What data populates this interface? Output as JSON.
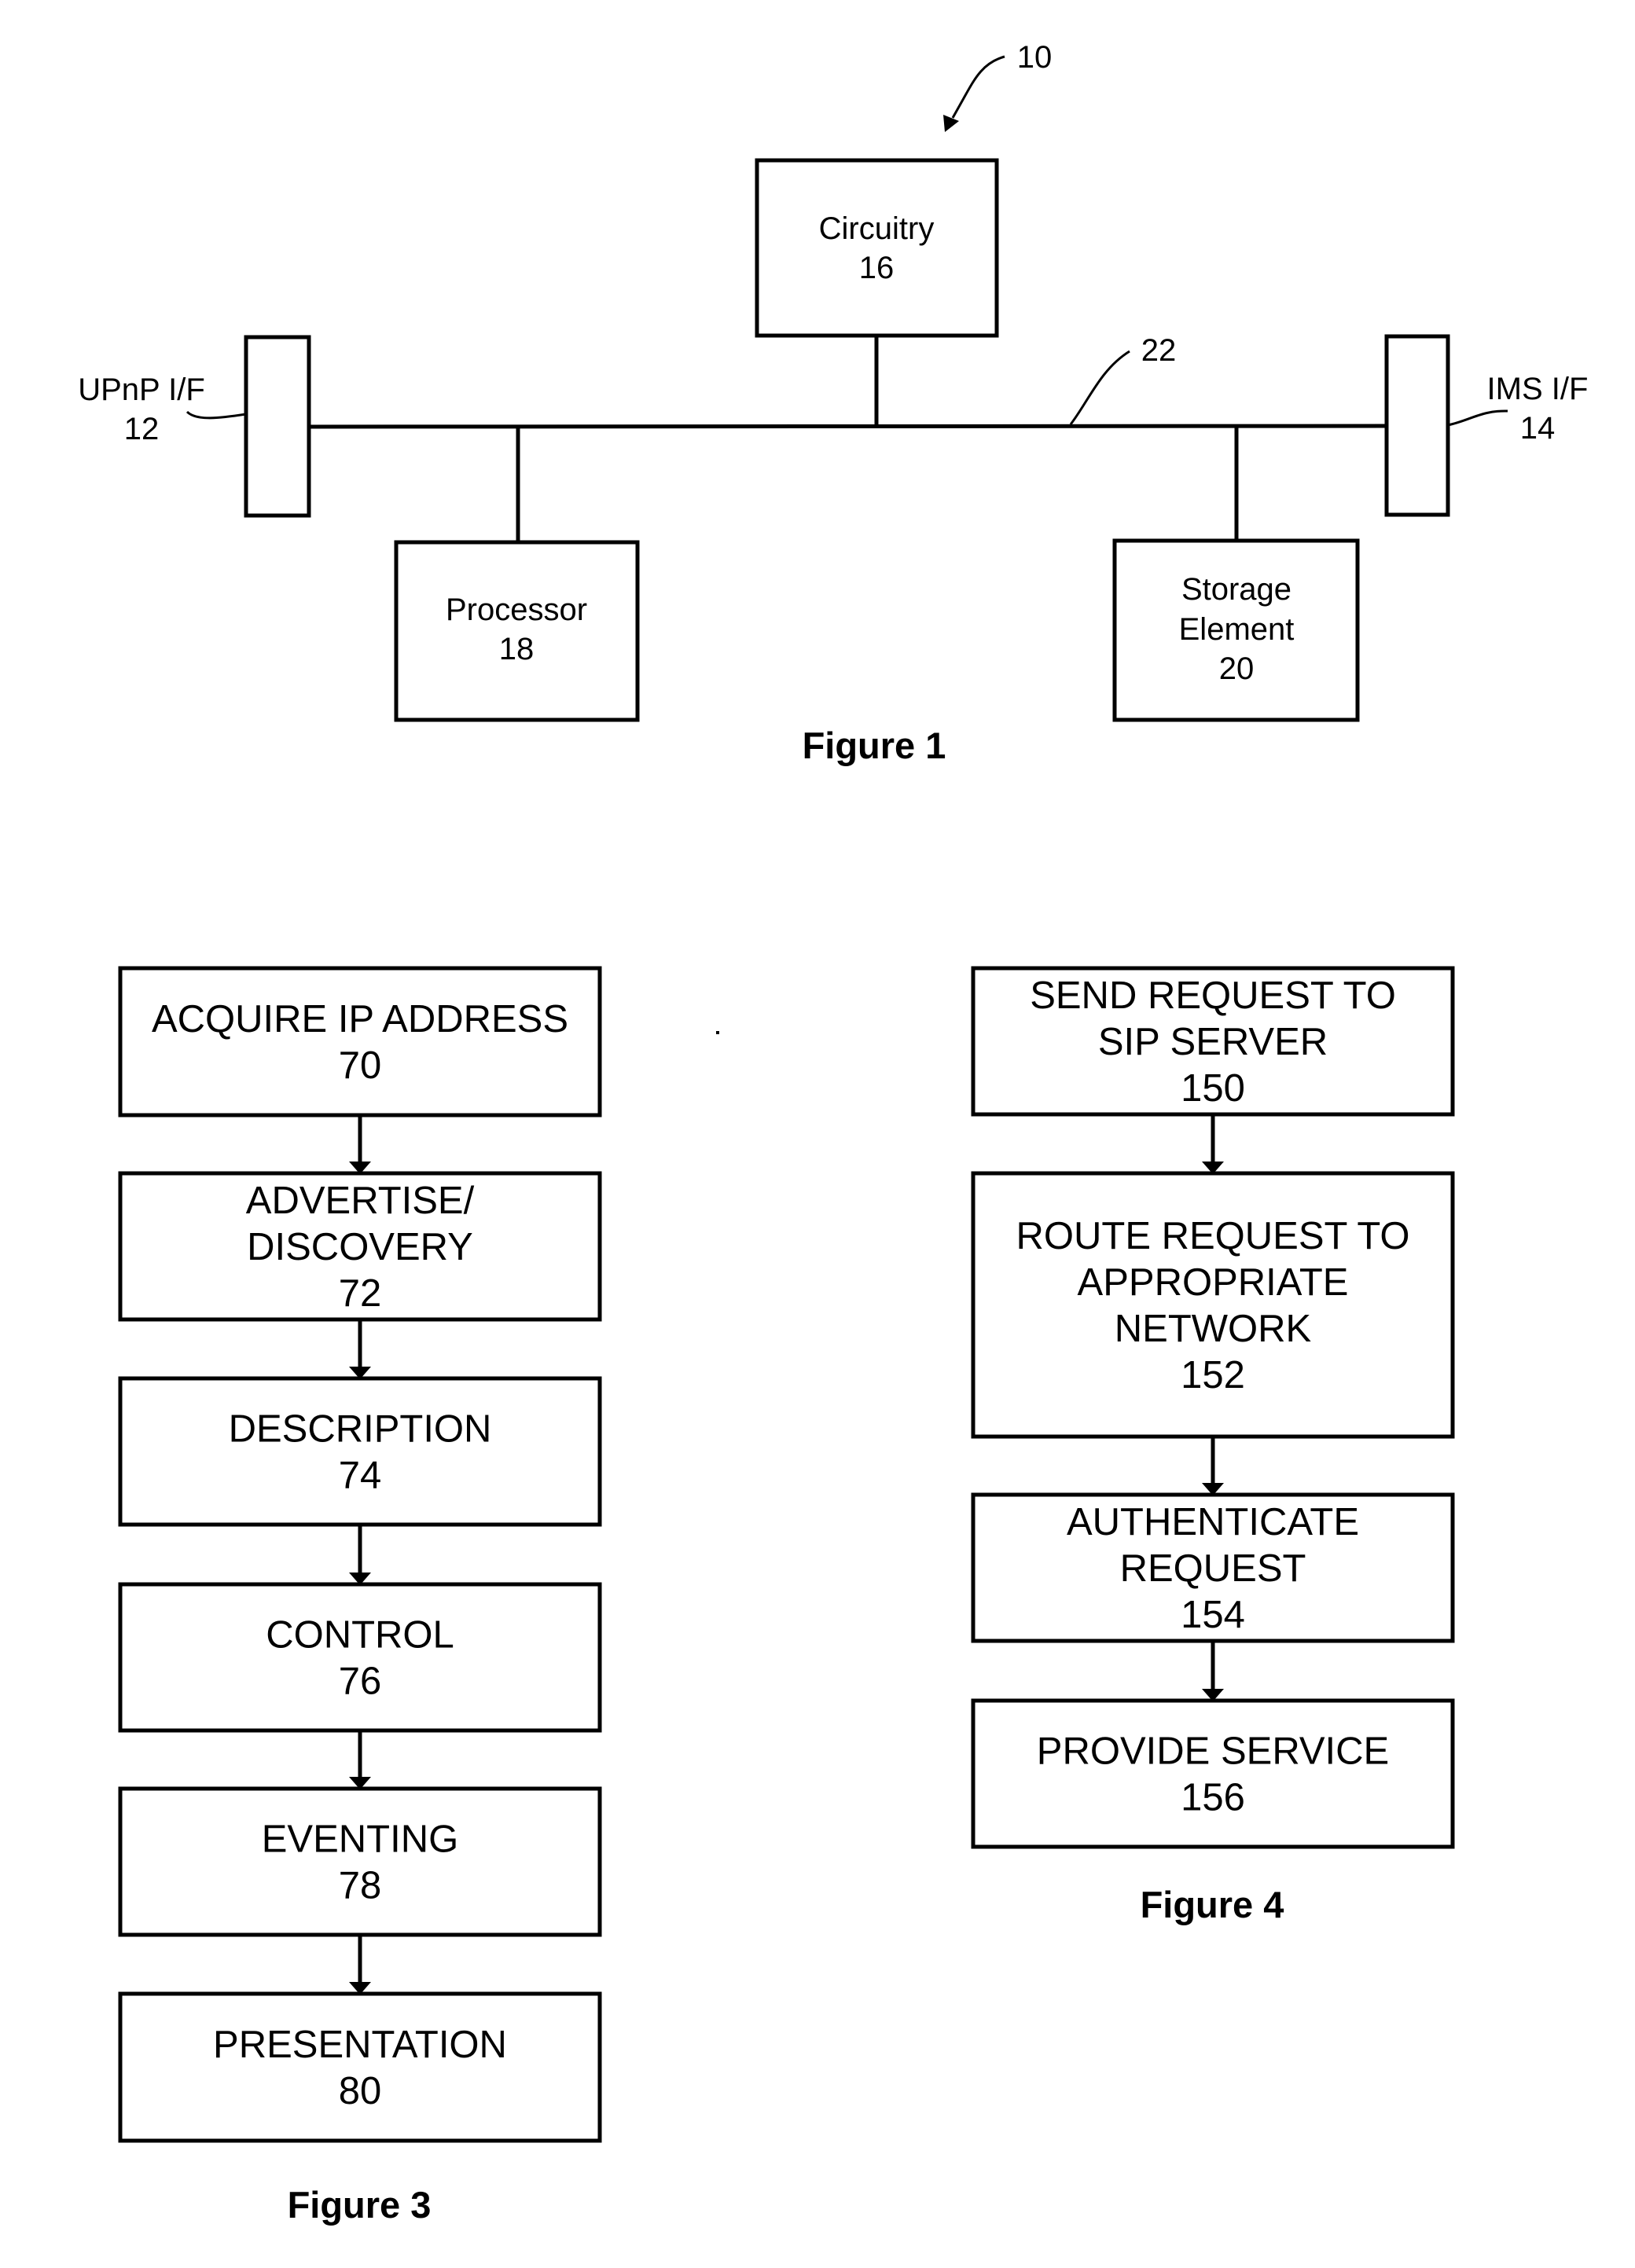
{
  "figure1": {
    "caption": "Figure 1",
    "system_ref": "10",
    "bus_ref": "22",
    "upnp_interface": {
      "lines": [
        "UPnP I/F",
        "12"
      ]
    },
    "ims_interface": {
      "lines": [
        "IMS I/F",
        "14"
      ]
    },
    "circuitry": {
      "lines": [
        "Circuitry",
        "16"
      ]
    },
    "processor": {
      "lines": [
        "Processor",
        "18"
      ]
    },
    "storage": {
      "lines": [
        "Storage",
        "Element",
        "20"
      ]
    }
  },
  "figure3": {
    "caption": "Figure 3",
    "steps": [
      {
        "lines": [
          "ACQUIRE IP ADDRESS",
          "70"
        ]
      },
      {
        "lines": [
          "ADVERTISE/",
          "DISCOVERY",
          "72"
        ]
      },
      {
        "lines": [
          "DESCRIPTION",
          "74"
        ]
      },
      {
        "lines": [
          "CONTROL",
          "76"
        ]
      },
      {
        "lines": [
          "EVENTING",
          "78"
        ]
      },
      {
        "lines": [
          "PRESENTATION",
          "80"
        ]
      }
    ]
  },
  "figure4": {
    "caption": "Figure 4",
    "steps": [
      {
        "lines": [
          "SEND REQUEST TO",
          "SIP SERVER",
          "150"
        ]
      },
      {
        "lines": [
          "ROUTE REQUEST TO",
          "APPROPRIATE",
          "NETWORK",
          "152"
        ]
      },
      {
        "lines": [
          "AUTHENTICATE",
          "REQUEST",
          "154"
        ]
      },
      {
        "lines": [
          "PROVIDE SERVICE",
          "156"
        ]
      }
    ]
  }
}
